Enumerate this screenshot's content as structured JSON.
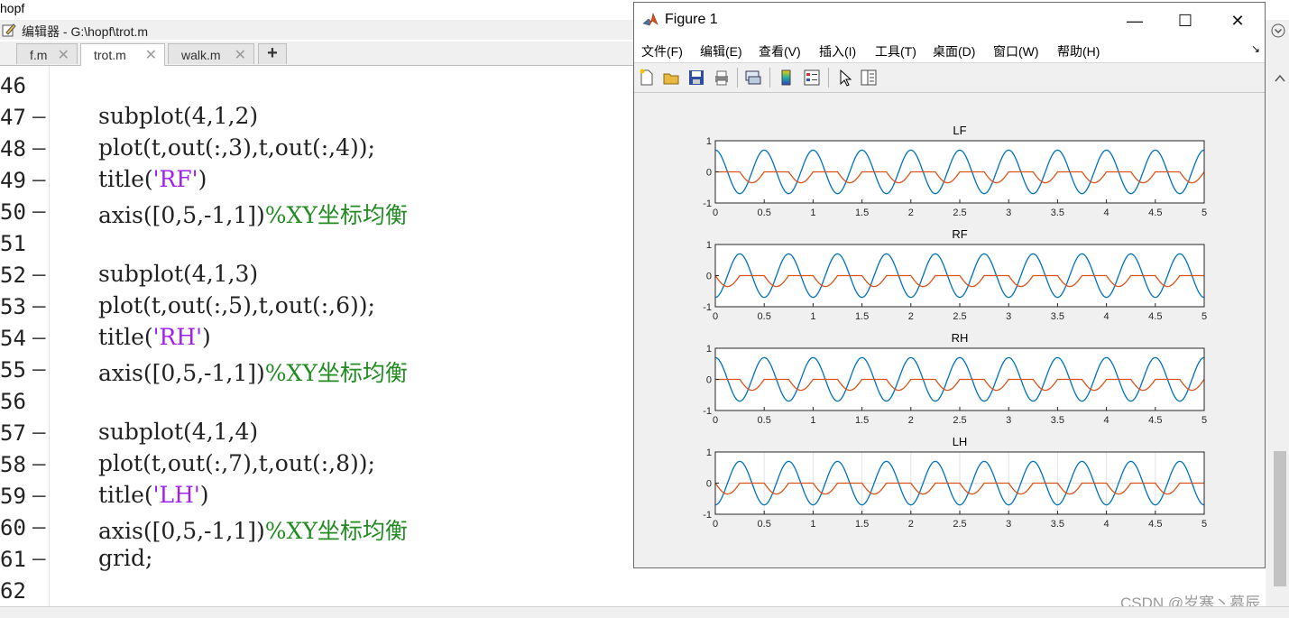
{
  "top_title": "hopf",
  "editor": {
    "title": "编辑器 - G:\\hopf\\trot.m",
    "tabs": [
      {
        "label": "f.m",
        "active": false
      },
      {
        "label": "trot.m",
        "active": true
      },
      {
        "label": "walk.m",
        "active": false
      }
    ],
    "tab_close": "✕",
    "add_tab": "+",
    "lines": [
      {
        "num": "46",
        "dash": false,
        "parts": []
      },
      {
        "num": "47",
        "dash": true,
        "parts": [
          {
            "t": "subplot(4,1,2)",
            "c": "code"
          }
        ]
      },
      {
        "num": "48",
        "dash": true,
        "parts": [
          {
            "t": "plot(t,out(:,3),t,out(:,4));",
            "c": "code"
          }
        ]
      },
      {
        "num": "49",
        "dash": true,
        "parts": [
          {
            "t": "title(",
            "c": "code"
          },
          {
            "t": "'RF'",
            "c": "str"
          },
          {
            "t": ")",
            "c": "code"
          }
        ]
      },
      {
        "num": "50",
        "dash": true,
        "parts": [
          {
            "t": "axis([0,5,-1,1])",
            "c": "code"
          },
          {
            "t": "%XY坐标均衡",
            "c": "cmt"
          }
        ]
      },
      {
        "num": "51",
        "dash": false,
        "parts": []
      },
      {
        "num": "52",
        "dash": true,
        "parts": [
          {
            "t": "subplot(4,1,3)",
            "c": "code"
          }
        ]
      },
      {
        "num": "53",
        "dash": true,
        "parts": [
          {
            "t": "plot(t,out(:,5),t,out(:,6));",
            "c": "code"
          }
        ]
      },
      {
        "num": "54",
        "dash": true,
        "parts": [
          {
            "t": "title(",
            "c": "code"
          },
          {
            "t": "'RH'",
            "c": "str"
          },
          {
            "t": ")",
            "c": "code"
          }
        ]
      },
      {
        "num": "55",
        "dash": true,
        "parts": [
          {
            "t": "axis([0,5,-1,1])",
            "c": "code"
          },
          {
            "t": "%XY坐标均衡",
            "c": "cmt"
          }
        ]
      },
      {
        "num": "56",
        "dash": false,
        "parts": []
      },
      {
        "num": "57",
        "dash": true,
        "parts": [
          {
            "t": "subplot(4,1,4)",
            "c": "code"
          }
        ]
      },
      {
        "num": "58",
        "dash": true,
        "parts": [
          {
            "t": "plot(t,out(:,7),t,out(:,8));",
            "c": "code"
          }
        ]
      },
      {
        "num": "59",
        "dash": true,
        "parts": [
          {
            "t": "title(",
            "c": "code"
          },
          {
            "t": "'LH'",
            "c": "str"
          },
          {
            "t": ")",
            "c": "code"
          }
        ]
      },
      {
        "num": "60",
        "dash": true,
        "parts": [
          {
            "t": "axis([0,5,-1,1])",
            "c": "code"
          },
          {
            "t": "%XY坐标均衡",
            "c": "cmt"
          }
        ]
      },
      {
        "num": "61",
        "dash": true,
        "parts": [
          {
            "t": "grid;",
            "c": "code"
          }
        ]
      },
      {
        "num": "62",
        "dash": false,
        "parts": []
      }
    ]
  },
  "figure": {
    "title": "Figure 1",
    "win_buttons": {
      "minimize": "—",
      "maximize": "☐",
      "close": "✕"
    },
    "menus": [
      "文件(F)",
      "编辑(E)",
      "查看(V)",
      "插入(I)",
      "工具(T)",
      "桌面(D)",
      "窗口(W)",
      "帮助(H)"
    ],
    "dock_arrow": "↘"
  },
  "watermark": "CSDN @岁寒丶慕辰",
  "chart_data": [
    {
      "type": "line",
      "title": "LF",
      "xlim": [
        0,
        5
      ],
      "ylim": [
        -1,
        1
      ],
      "xticks": [
        "0",
        "0.5",
        "1",
        "1.5",
        "2",
        "2.5",
        "3",
        "3.5",
        "4",
        "4.5",
        "5"
      ],
      "yticks": [
        "1",
        "0",
        "-1"
      ],
      "grid": false,
      "series": [
        {
          "color": "#0072bd",
          "frequency": 2,
          "amplitude": 0.7,
          "phase": 0.0
        },
        {
          "color": "#d95319",
          "frequency": 2,
          "amplitude": 0.35,
          "phase": 0.0
        }
      ]
    },
    {
      "type": "line",
      "title": "RF",
      "xlim": [
        0,
        5
      ],
      "ylim": [
        -1,
        1
      ],
      "xticks": [
        "0",
        "0.5",
        "1",
        "1.5",
        "2",
        "2.5",
        "3",
        "3.5",
        "4",
        "4.5",
        "5"
      ],
      "yticks": [
        "1",
        "0",
        "-1"
      ],
      "grid": false,
      "series": [
        {
          "color": "#0072bd",
          "frequency": 2,
          "amplitude": 0.7,
          "phase": 3.1416
        },
        {
          "color": "#d95319",
          "frequency": 2,
          "amplitude": 0.35,
          "phase": 3.1416
        }
      ]
    },
    {
      "type": "line",
      "title": "RH",
      "xlim": [
        0,
        5
      ],
      "ylim": [
        -1,
        1
      ],
      "xticks": [
        "0",
        "0.5",
        "1",
        "1.5",
        "2",
        "2.5",
        "3",
        "3.5",
        "4",
        "4.5",
        "5"
      ],
      "yticks": [
        "1",
        "0",
        "-1"
      ],
      "grid": false,
      "series": [
        {
          "color": "#0072bd",
          "frequency": 2,
          "amplitude": 0.7,
          "phase": 0.0
        },
        {
          "color": "#d95319",
          "frequency": 2,
          "amplitude": 0.35,
          "phase": 0.0
        }
      ]
    },
    {
      "type": "line",
      "title": "LH",
      "xlim": [
        0,
        5
      ],
      "ylim": [
        -1,
        1
      ],
      "xticks": [
        "0",
        "0.5",
        "1",
        "1.5",
        "2",
        "2.5",
        "3",
        "3.5",
        "4",
        "4.5",
        "5"
      ],
      "yticks": [
        "1",
        "0",
        "-1"
      ],
      "grid": true,
      "series": [
        {
          "color": "#0072bd",
          "frequency": 2,
          "amplitude": 0.7,
          "phase": 3.1416
        },
        {
          "color": "#d95319",
          "frequency": 2,
          "amplitude": 0.35,
          "phase": 3.1416
        }
      ]
    }
  ]
}
